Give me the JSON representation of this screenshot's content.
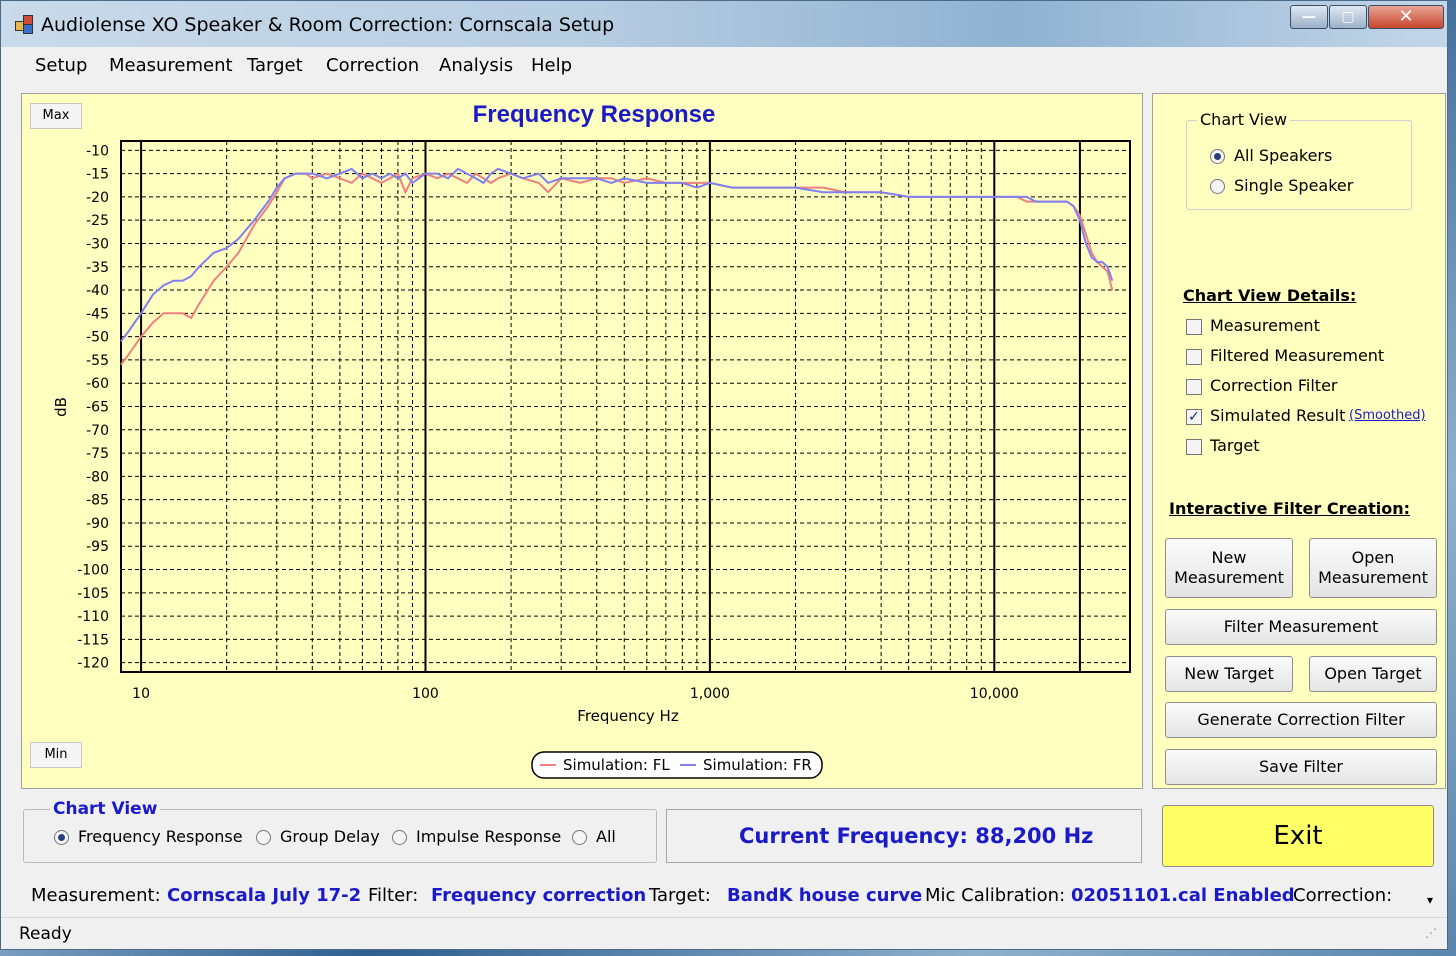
{
  "window": {
    "title": "Audiolense XO Speaker & Room Correction: Cornscala Setup",
    "controls": {
      "minimize": "—",
      "maximize": "▢",
      "close": "✕"
    }
  },
  "menu": [
    "Setup",
    "Measurement",
    "Target",
    "Correction",
    "Analysis",
    "Help"
  ],
  "chart_panel": {
    "max_label": "Max",
    "min_label": "Min"
  },
  "chart_data": {
    "type": "line",
    "title": "Frequency Response",
    "xlabel": "Frequency Hz",
    "ylabel": "dB",
    "xscale": "log",
    "xlim": [
      8.5,
      30000
    ],
    "ylim": [
      -122,
      -8
    ],
    "yticks": [
      -10,
      -15,
      -20,
      -25,
      -30,
      -35,
      -40,
      -45,
      -50,
      -55,
      -60,
      -65,
      -70,
      -75,
      -80,
      -85,
      -90,
      -95,
      -100,
      -105,
      -110,
      -115,
      -120
    ],
    "xticks": [
      10,
      100,
      1000,
      10000
    ],
    "xtick_labels": [
      "10",
      "100",
      "1,000",
      "10,000"
    ],
    "grid": true,
    "legend_placement": "bottom-center",
    "series": [
      {
        "name": "Simulation: FL",
        "color": "#f08080",
        "x": [
          8.5,
          9,
          10,
          11,
          12,
          13,
          14,
          15,
          16,
          18,
          20,
          22,
          25,
          28,
          30,
          32,
          35,
          38,
          40,
          45,
          50,
          55,
          60,
          65,
          70,
          75,
          80,
          85,
          90,
          100,
          110,
          120,
          130,
          140,
          150,
          160,
          170,
          180,
          200,
          220,
          250,
          270,
          300,
          350,
          400,
          450,
          500,
          600,
          700,
          800,
          900,
          1000,
          1200,
          1500,
          1800,
          2000,
          2500,
          3000,
          3500,
          4000,
          5000,
          6000,
          7000,
          8000,
          9000,
          10000,
          11000,
          12000,
          13000,
          14000,
          15000,
          16000,
          17000,
          18000,
          19000,
          20000,
          21000,
          22000,
          23000,
          24000,
          25000,
          26000
        ],
        "y": [
          -56,
          -54,
          -50,
          -47,
          -45,
          -45,
          -45,
          -46,
          -43,
          -38,
          -35,
          -32,
          -26,
          -22,
          -19,
          -16,
          -15,
          -15,
          -16,
          -15,
          -16,
          -17,
          -15,
          -16,
          -17,
          -16,
          -15,
          -19,
          -16,
          -15,
          -16,
          -15,
          -16,
          -17,
          -15,
          -16,
          -17,
          -16,
          -15,
          -16,
          -17,
          -19,
          -16,
          -17,
          -16,
          -16,
          -17,
          -16,
          -17,
          -17,
          -17,
          -17,
          -18,
          -18,
          -18,
          -18,
          -18,
          -19,
          -19,
          -19,
          -20,
          -20,
          -20,
          -20,
          -20,
          -20,
          -20,
          -20,
          -21,
          -21,
          -21,
          -21,
          -21,
          -21,
          -22,
          -24,
          -28,
          -32,
          -34,
          -35,
          -36,
          -40
        ]
      },
      {
        "name": "Simulation: FR",
        "color": "#8080f0",
        "x": [
          8.5,
          9,
          10,
          11,
          12,
          13,
          14,
          15,
          16,
          18,
          20,
          22,
          25,
          28,
          30,
          32,
          35,
          38,
          40,
          45,
          50,
          55,
          60,
          65,
          70,
          75,
          80,
          85,
          90,
          100,
          110,
          120,
          130,
          140,
          150,
          160,
          170,
          180,
          200,
          220,
          250,
          270,
          300,
          350,
          400,
          450,
          500,
          600,
          700,
          800,
          900,
          1000,
          1200,
          1500,
          1800,
          2000,
          2500,
          3000,
          3500,
          4000,
          5000,
          6000,
          7000,
          8000,
          9000,
          10000,
          11000,
          12000,
          13000,
          14000,
          15000,
          16000,
          17000,
          18000,
          19000,
          20000,
          21000,
          22000,
          23000,
          24000,
          25000,
          26000
        ],
        "y": [
          -51,
          -49,
          -45,
          -41,
          -39,
          -38,
          -38,
          -37,
          -35,
          -32,
          -31,
          -29,
          -25,
          -21,
          -18,
          -16,
          -15,
          -15,
          -15,
          -16,
          -15,
          -14,
          -16,
          -15,
          -16,
          -15,
          -16,
          -15,
          -17,
          -15,
          -15,
          -16,
          -14,
          -15,
          -16,
          -17,
          -15,
          -14,
          -15,
          -16,
          -15,
          -17,
          -16,
          -16,
          -16,
          -17,
          -16,
          -17,
          -17,
          -17,
          -18,
          -17,
          -18,
          -18,
          -18,
          -18,
          -19,
          -19,
          -19,
          -19,
          -20,
          -20,
          -20,
          -20,
          -20,
          -20,
          -20,
          -20,
          -20,
          -21,
          -21,
          -21,
          -21,
          -21,
          -22,
          -25,
          -30,
          -33,
          -34,
          -34,
          -35,
          -38
        ]
      }
    ]
  },
  "right_panel": {
    "chart_view_group": {
      "label": "Chart View",
      "options": [
        {
          "label": "All Speakers",
          "checked": true
        },
        {
          "label": "Single Speaker",
          "checked": false
        }
      ]
    },
    "details_title": "Chart View Details:",
    "details": [
      {
        "label": "Measurement",
        "checked": false
      },
      {
        "label": "Filtered Measurement",
        "checked": false
      },
      {
        "label": "Correction Filter",
        "checked": false
      },
      {
        "label": "Simulated Result",
        "checked": true
      },
      {
        "label": "Target",
        "checked": false
      }
    ],
    "smoothed_link": "(Smoothed)",
    "interactive_title": "Interactive Filter Creation:",
    "buttons": {
      "new_measurement_1": "New",
      "new_measurement_2": "Measurement",
      "open_measurement_1": "Open",
      "open_measurement_2": "Measurement",
      "filter_measurement": "Filter Measurement",
      "new_target": "New Target",
      "open_target": "Open Target",
      "generate_correction_filter": "Generate Correction Filter",
      "save_filter": "Save Filter"
    }
  },
  "bottom_chart_view": {
    "label": "Chart View",
    "options": [
      {
        "label": "Frequency Response",
        "checked": true
      },
      {
        "label": "Group Delay",
        "checked": false
      },
      {
        "label": "Impulse Response",
        "checked": false
      },
      {
        "label": "All",
        "checked": false
      }
    ]
  },
  "current_frequency": "Current Frequency: 88,200 Hz",
  "exit_label": "Exit",
  "status_info": {
    "measurement_label": "Measurement:",
    "measurement_value": "Cornscala July 17-2",
    "filter_label": "Filter:",
    "filter_value": "Frequency correction",
    "target_label": "Target:",
    "target_value": "BandK house curve",
    "mic_label": "Mic Calibration:",
    "mic_value": "02051101.cal Enabled",
    "correction_label": "Correction:"
  },
  "status_bar": "Ready",
  "colors": {
    "chart_background": "#ffffc0",
    "title_blue": "#1a1ac8",
    "exit_yellow": "#ffff66",
    "series_fl": "#f08080",
    "series_fr": "#8080f0"
  }
}
